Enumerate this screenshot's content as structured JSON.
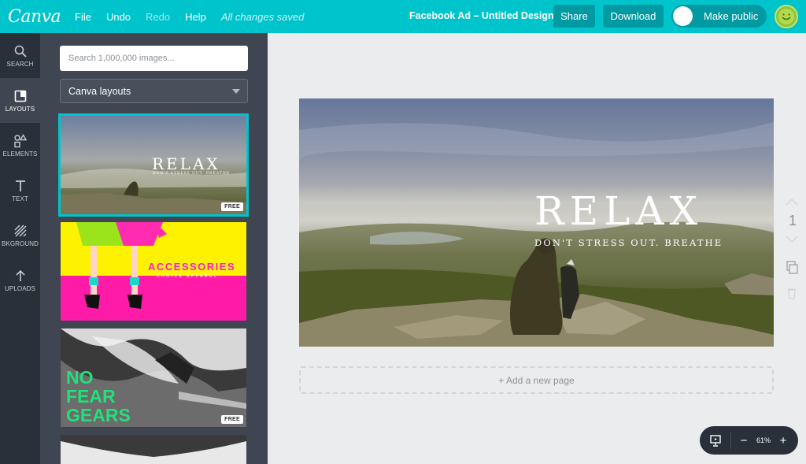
{
  "topbar": {
    "logo": "Canva",
    "menu": [
      "File",
      "Undo",
      "Redo",
      "Help"
    ],
    "saved_status": "All changes saved",
    "doc_title": "Facebook Ad – Untitled Design",
    "share_label": "Share",
    "download_label": "Download",
    "make_public_label": "Make public"
  },
  "rail": [
    {
      "label": "SEARCH",
      "icon": "search-icon"
    },
    {
      "label": "LAYOUTS",
      "icon": "layouts-icon"
    },
    {
      "label": "ELEMENTS",
      "icon": "elements-icon"
    },
    {
      "label": "TEXT",
      "icon": "text-icon"
    },
    {
      "label": "BKGROUND",
      "icon": "background-icon"
    },
    {
      "label": "UPLOADS",
      "icon": "upload-icon"
    }
  ],
  "panel": {
    "search_placeholder": "Search 1,000,000 images...",
    "layout_select": "Canva layouts",
    "thumbs": [
      {
        "title": "RELAX",
        "subtitle": "DON'T STRESS OUT. BREATHE",
        "badge": "FREE"
      },
      {
        "title": "ACCESSORIES",
        "subtitle": "CHOICE APPAREL"
      },
      {
        "title_line1": "NO",
        "title_line2": "FEAR",
        "title_line3": "GEARS",
        "badge": "FREE"
      }
    ]
  },
  "canvas": {
    "title": "RELAX",
    "subtitle": "DON'T STRESS OUT. BREATHE"
  },
  "add_page_label": "+ Add a new page",
  "page_number": "1",
  "zoom": {
    "minus": "−",
    "level": "61%",
    "plus": "+"
  },
  "colors": {
    "brand": "#00c4cc",
    "rail_bg": "#293039",
    "panel_bg": "#3f4651",
    "workspace_bg": "#ebecee"
  }
}
